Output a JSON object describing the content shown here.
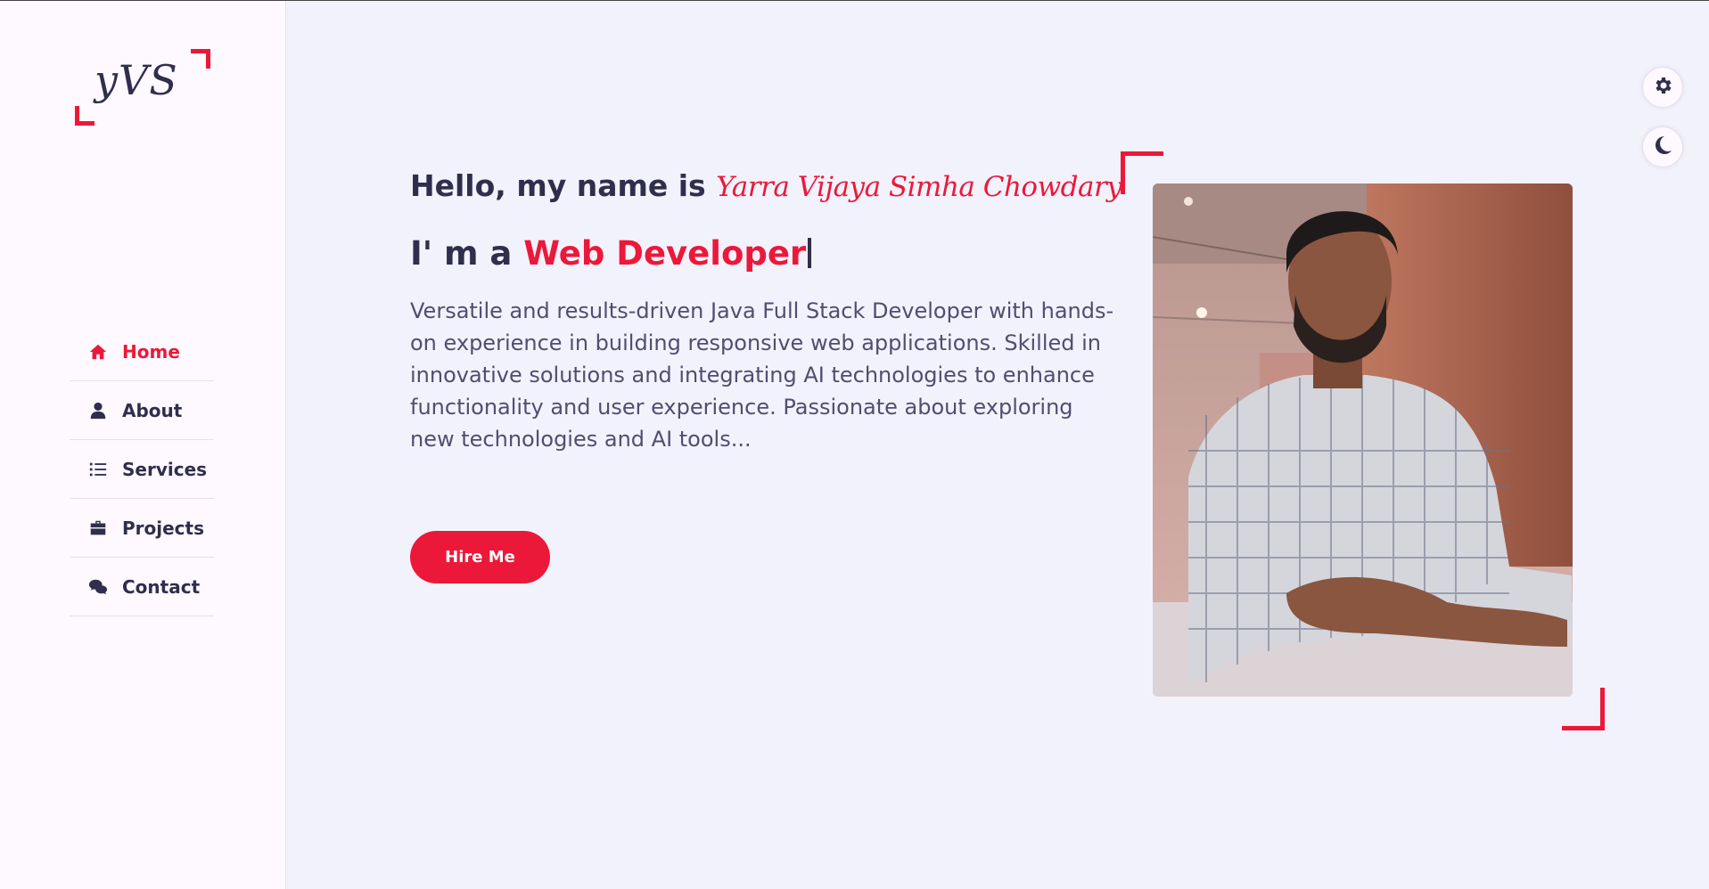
{
  "colors": {
    "accent": "#ec1839",
    "text": "#302e4d",
    "body_text": "#504e70",
    "page_bg": "#f2f2fc",
    "aside_bg": "#fdf9ff"
  },
  "logo": {
    "text": "yVS"
  },
  "nav": {
    "items": [
      {
        "label": "Home",
        "icon": "home-icon",
        "active": true
      },
      {
        "label": "About",
        "icon": "user-icon",
        "active": false
      },
      {
        "label": "Services",
        "icon": "list-icon",
        "active": false
      },
      {
        "label": "Projects",
        "icon": "briefcase-icon",
        "active": false
      },
      {
        "label": "Contact",
        "icon": "comments-icon",
        "active": false
      }
    ]
  },
  "home": {
    "hello_prefix": "Hello, my name is",
    "name": "Yarra Vijaya Simha Chowdary",
    "role_prefix": "I' m a",
    "role": "Web Developer",
    "description": "Versatile and results-driven Java Full Stack Developer with hands-on experience in building responsive web applications. Skilled in innovative solutions and integrating AI technologies to enhance functionality and user experience. Passionate about exploring new technologies and AI tools...",
    "hire_label": "Hire Me"
  },
  "style_switcher": {
    "settings_icon": "gear-icon",
    "theme_icon": "moon-icon"
  }
}
